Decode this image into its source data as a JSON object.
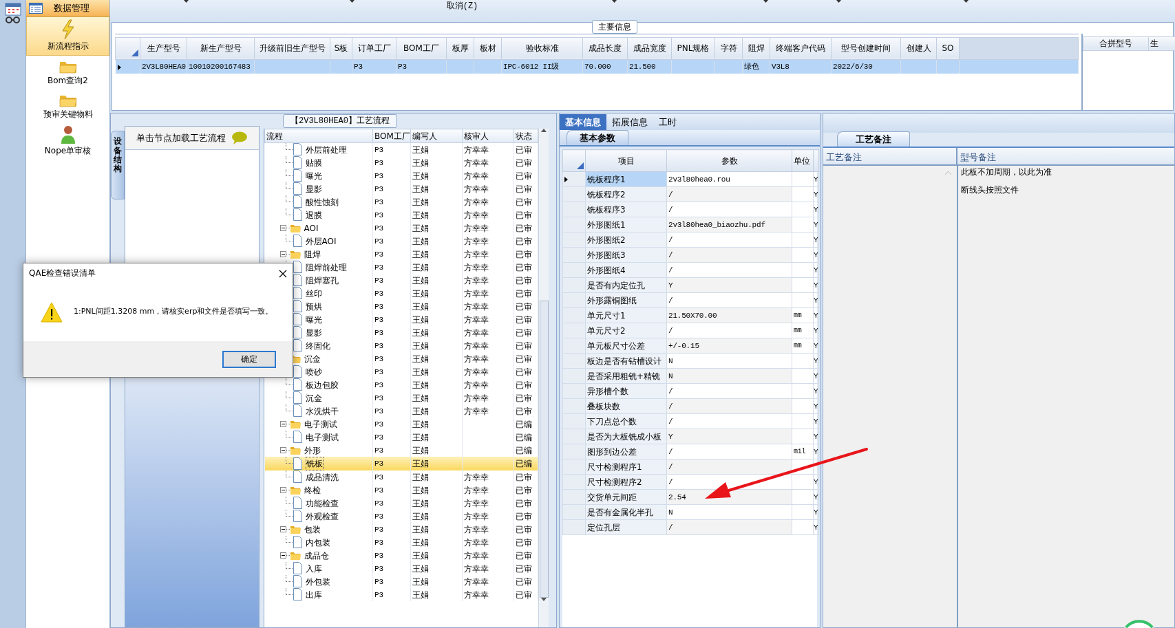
{
  "toolbar": {
    "cancel_label": "取消(Z)"
  },
  "nav": {
    "header": "数据管理",
    "items": [
      {
        "label": "新流程指示",
        "kind": "lightning",
        "selected": true
      },
      {
        "label": "Bom查询2",
        "kind": "folder",
        "selected": false
      },
      {
        "label": "预审关键物料",
        "kind": "folder",
        "selected": false
      },
      {
        "label": "Nope单审核",
        "kind": "person",
        "selected": false
      }
    ]
  },
  "main_info": {
    "title": "主要信息",
    "columns": [
      "生产型号",
      "新生产型号",
      "升级前旧生产型号",
      "S板",
      "订单工厂",
      "BOM工厂",
      "板厚",
      "板材",
      "验收标准",
      "成品长度",
      "成品宽度",
      "PNL规格",
      "字符",
      "阻焊",
      "终端客户代码",
      "型号创建时间",
      "创建人",
      "SO"
    ],
    "rows": [
      {
        "selected": true,
        "cells": [
          "2V3L80HEA0",
          "10010200167483",
          null,
          null,
          "P3",
          "P3",
          null,
          null,
          "IPC-6012 II级",
          "70.000",
          "21.500",
          null,
          null,
          "绿色",
          "V3L8",
          "2022/6/30",
          null,
          null
        ]
      }
    ],
    "merge_panel": {
      "columns": [
        "合拼型号",
        "生"
      ]
    }
  },
  "process_panel": {
    "title": "【2V3L80HEA0】工艺流程",
    "side_tab": "设备结构",
    "hint": "单击节点加载工艺流程",
    "tree": {
      "columns": [
        "流程",
        "BOM工厂",
        "编写人",
        "核审人",
        "状态"
      ],
      "nodes": [
        {
          "children": [
            {
              "label": "外层前处理",
              "bom": "P3",
              "writer": "王娟",
              "reviewer": "方幸幸",
              "status": "已审",
              "selected": false
            },
            {
              "label": "贴膜",
              "bom": "P3",
              "writer": "王娟",
              "reviewer": "方幸幸",
              "status": "已审",
              "selected": false
            },
            {
              "label": "曝光",
              "bom": "P3",
              "writer": "王娟",
              "reviewer": "方幸幸",
              "status": "已审",
              "selected": false
            },
            {
              "label": "显影",
              "bom": "P3",
              "writer": "王娟",
              "reviewer": "方幸幸",
              "status": "已审",
              "selected": false
            },
            {
              "label": "酸性蚀刻",
              "bom": "P3",
              "writer": "王娟",
              "reviewer": "方幸幸",
              "status": "已审",
              "selected": false
            },
            {
              "label": "退膜",
              "bom": "P3",
              "writer": "王娟",
              "reviewer": "方幸幸",
              "status": "已审",
              "selected": false
            }
          ]
        },
        {
          "label": "AOI",
          "bom": "P3",
          "writer": "王娟",
          "reviewer": "方幸幸",
          "status": "已审",
          "expanded": true,
          "selected": false,
          "children": [
            {
              "label": "外层AOI",
              "bom": "P3",
              "writer": "王娟",
              "reviewer": "方幸幸",
              "status": "已审",
              "selected": false
            }
          ]
        },
        {
          "label": "阻焊",
          "bom": "P3",
          "writer": "王娟",
          "reviewer": "方幸幸",
          "status": "已审",
          "expanded": true,
          "selected": false,
          "children": [
            {
              "label": "阻焊前处理",
              "bom": "P3",
              "writer": "王娟",
              "reviewer": "方幸幸",
              "status": "已审",
              "selected": false
            },
            {
              "label": "阻焊塞孔",
              "bom": "P3",
              "writer": "王娟",
              "reviewer": "方幸幸",
              "status": "已审",
              "selected": false
            },
            {
              "label": "丝印",
              "bom": "P3",
              "writer": "王娟",
              "reviewer": "方幸幸",
              "status": "已审",
              "selected": false
            },
            {
              "label": "预烘",
              "bom": "P3",
              "writer": "王娟",
              "reviewer": "方幸幸",
              "status": "已审",
              "selected": false
            },
            {
              "label": "曝光",
              "bom": "P3",
              "writer": "王娟",
              "reviewer": "方幸幸",
              "status": "已审",
              "selected": false
            },
            {
              "label": "显影",
              "bom": "P3",
              "writer": "王娟",
              "reviewer": "方幸幸",
              "status": "已审",
              "selected": false
            },
            {
              "label": "终固化",
              "bom": "P3",
              "writer": "王娟",
              "reviewer": "方幸幸",
              "status": "已审",
              "selected": false
            }
          ]
        },
        {
          "label": "沉金",
          "bom": "P3",
          "writer": "王娟",
          "reviewer": "方幸幸",
          "status": "已审",
          "selected": false,
          "children": [
            {
              "label": "喷砂",
              "bom": "P3",
              "writer": "王娟",
              "reviewer": "方幸幸",
              "status": "已审",
              "selected": false
            },
            {
              "label": "板边包胶",
              "bom": "P3",
              "writer": "王娟",
              "reviewer": "方幸幸",
              "status": "已审",
              "selected": false
            },
            {
              "label": "沉金",
              "bom": "P3",
              "writer": "王娟",
              "reviewer": "方幸幸",
              "status": "已审",
              "selected": false
            },
            {
              "label": "水洗烘干",
              "bom": "P3",
              "writer": "王娟",
              "reviewer": "方幸幸",
              "status": "已审",
              "selected": false
            }
          ]
        },
        {
          "label": "电子测试",
          "bom": "P3",
          "writer": "王娟",
          "status": "已编",
          "expanded": true,
          "selected": false,
          "children": [
            {
              "label": "电子测试",
              "bom": "P3",
              "writer": "王娟",
              "status": "已编",
              "selected": false
            }
          ]
        },
        {
          "label": "外形",
          "bom": "P3",
          "writer": "王娟",
          "status": "已编",
          "expanded": true,
          "selected": false,
          "children": [
            {
              "label": "铣板",
              "bom": "P3",
              "writer": "王娟",
              "status": "已编",
              "selected": true
            },
            {
              "label": "成品清洗",
              "bom": "P3",
              "writer": "王娟",
              "reviewer": "方幸幸",
              "status": "已审",
              "selected": false
            }
          ]
        },
        {
          "label": "终检",
          "bom": "P3",
          "writer": "王娟",
          "reviewer": "方幸幸",
          "status": "已审",
          "expanded": true,
          "selected": false,
          "children": [
            {
              "label": "功能检查",
              "bom": "P3",
              "writer": "王娟",
              "reviewer": "方幸幸",
              "status": "已审",
              "selected": false
            },
            {
              "label": "外观检查",
              "bom": "P3",
              "writer": "王娟",
              "reviewer": "方幸幸",
              "status": "已审",
              "selected": false
            }
          ]
        },
        {
          "label": "包装",
          "bom": "P3",
          "writer": "王娟",
          "reviewer": "方幸幸",
          "status": "已审",
          "expanded": true,
          "selected": false,
          "children": [
            {
              "label": "内包装",
              "bom": "P3",
              "writer": "王娟",
              "reviewer": "方幸幸",
              "status": "已审",
              "selected": false
            }
          ]
        },
        {
          "label": "成品仓",
          "bom": "P3",
          "writer": "王娟",
          "reviewer": "方幸幸",
          "status": "已审",
          "expanded": true,
          "selected": false,
          "children": [
            {
              "label": "入库",
              "bom": "P3",
              "writer": "王娟",
              "reviewer": "方幸幸",
              "status": "已审",
              "selected": false
            },
            {
              "label": "外包装",
              "bom": "P3",
              "writer": "王娟",
              "reviewer": "方幸幸",
              "status": "已审",
              "selected": false
            },
            {
              "label": "出库",
              "bom": "P3",
              "writer": "王娟",
              "reviewer": "方幸幸",
              "status": "已审",
              "selected": false
            }
          ]
        }
      ]
    }
  },
  "basic_info": {
    "tabs": [
      {
        "label": "基本信息",
        "selected": true
      },
      {
        "label": "拓展信息",
        "selected": false
      },
      {
        "label": "工时",
        "selected": false
      }
    ],
    "sub_tab": "基本参数",
    "columns": [
      "项目",
      "参数",
      "单位"
    ],
    "rows": [
      {
        "item": "铣板程序1",
        "value": "2v3l80hea0.rou",
        "column_4": "Y",
        "selected": true
      },
      {
        "item": "铣板程序2",
        "value": "/",
        "column_4": "Y",
        "selected": false
      },
      {
        "item": "铣板程序3",
        "value": "/",
        "column_4": "Y",
        "selected": false
      },
      {
        "item": "外形图纸1",
        "value": "2v3l80hea0_biaozhu.pdf",
        "column_4": "Y",
        "selected": false
      },
      {
        "item": "外形图纸2",
        "value": "/",
        "column_4": "Y",
        "selected": false
      },
      {
        "item": "外形图纸3",
        "value": "/",
        "column_4": "Y",
        "selected": false
      },
      {
        "item": "外形图纸4",
        "value": "/",
        "column_4": "Y",
        "selected": false
      },
      {
        "item": "是否有内定位孔",
        "value": "Y",
        "column_4": "Y",
        "selected": false
      },
      {
        "item": "外形露铜图纸",
        "value": "/",
        "column_4": "Y",
        "selected": false
      },
      {
        "item": "单元尺寸1",
        "value": "21.50X70.00",
        "unit": "mm",
        "column_4": "Y",
        "selected": false
      },
      {
        "item": "单元尺寸2",
        "value": "/",
        "unit": "mm",
        "column_4": "Y",
        "selected": false
      },
      {
        "item": "单元板尺寸公差",
        "value": "+/-0.15",
        "unit": "mm",
        "column_4": "Y",
        "selected": false
      },
      {
        "item": "板边是否有钻槽设计",
        "value": "N",
        "column_4": "Y",
        "selected": false
      },
      {
        "item": "是否采用粗铣+精铣",
        "value": "N",
        "column_4": "Y",
        "selected": false
      },
      {
        "item": "异形槽个数",
        "value": "/",
        "column_4": "Y",
        "selected": false
      },
      {
        "item": "叠板块数",
        "value": "/",
        "column_4": "Y",
        "selected": false
      },
      {
        "item": "下刀点总个数",
        "value": "/",
        "column_4": "Y",
        "selected": false
      },
      {
        "item": "是否为大板铣成小板",
        "value": "Y",
        "column_4": "Y",
        "selected": false
      },
      {
        "item": "图形到边公差",
        "value": "/",
        "unit": "mil",
        "column_4": "Y",
        "selected": false
      },
      {
        "item": "尺寸检测程序1",
        "value": "/",
        "selected": false
      },
      {
        "item": "尺寸检测程序2",
        "value": "/",
        "column_4": "Y",
        "selected": false
      },
      {
        "item": "交货单元间距",
        "value": "2.54",
        "column_4": "Y",
        "selected": false
      },
      {
        "item": "是否有金属化半孔",
        "value": "N",
        "column_4": "Y",
        "selected": false
      },
      {
        "item": "定位孔层",
        "value": "/",
        "column_4": "Y",
        "selected": false
      }
    ]
  },
  "notes": {
    "tab": "工艺备注",
    "columns": [
      "工艺备注",
      "型号备注"
    ],
    "model_notes": [
      "此板不加周期，以此为准",
      "断线头按照文件"
    ]
  },
  "dialog": {
    "title": "QAE检查错误清单",
    "message": "1:PNL间距1.3208 mm，请核实erp和文件是否填写一致。",
    "button": "确定"
  }
}
